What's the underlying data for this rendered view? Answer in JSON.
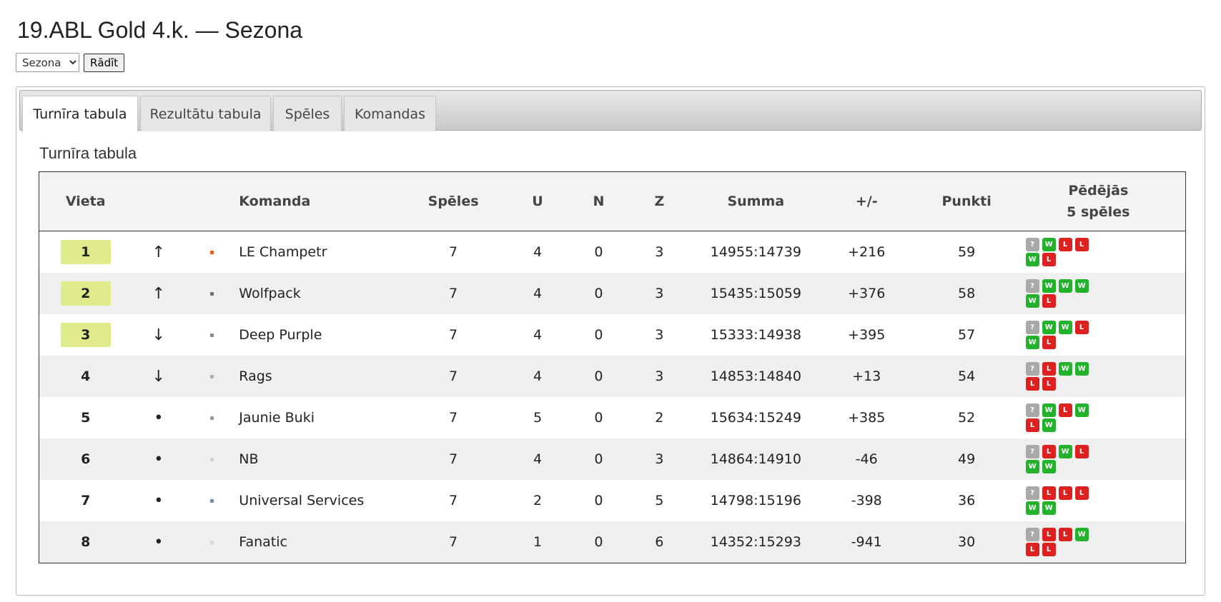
{
  "page": {
    "title": "19.ABL Gold 4.k. — Sezona"
  },
  "controls": {
    "season_selected": "Sezona",
    "show_button": "Rādīt"
  },
  "tabs": [
    {
      "label": "Turnīra tabula",
      "active": true
    },
    {
      "label": "Rezultātu tabula",
      "active": false
    },
    {
      "label": "Spēles",
      "active": false
    },
    {
      "label": "Komandas",
      "active": false
    }
  ],
  "section_title": "Turnīra tabula",
  "table": {
    "headers": {
      "place": "Vieta",
      "team": "Komanda",
      "games": "Spēles",
      "wins": "U",
      "draws": "N",
      "losses": "Z",
      "sum": "Summa",
      "diff": "+/-",
      "points": "Punkti",
      "last5_line1": "Pēdējās",
      "last5_line2": "5 spēles"
    },
    "rows": [
      {
        "place": "1",
        "trend": "↑",
        "logo_color": "#e85a1e",
        "team": "LE Champetr",
        "games": "7",
        "wins": "4",
        "draws": "0",
        "losses": "3",
        "sum": "14955:14739",
        "diff": "+216",
        "points": "59",
        "form": [
          "?",
          "W",
          "L",
          "L",
          "W",
          "L"
        ]
      },
      {
        "place": "2",
        "trend": "↑",
        "logo_color": "#6f6f6f",
        "team": "Wolfpack",
        "games": "7",
        "wins": "4",
        "draws": "0",
        "losses": "3",
        "sum": "15435:15059",
        "diff": "+376",
        "points": "58",
        "form": [
          "?",
          "W",
          "W",
          "W",
          "W",
          "L"
        ]
      },
      {
        "place": "3",
        "trend": "↓",
        "logo_color": "#8a8a8a",
        "team": "Deep Purple",
        "games": "7",
        "wins": "4",
        "draws": "0",
        "losses": "3",
        "sum": "15333:14938",
        "diff": "+395",
        "points": "57",
        "form": [
          "?",
          "W",
          "W",
          "L",
          "W",
          "L"
        ]
      },
      {
        "place": "4",
        "trend": "↓",
        "logo_color": "#b0b0b0",
        "team": "Rags",
        "games": "7",
        "wins": "4",
        "draws": "0",
        "losses": "3",
        "sum": "14853:14840",
        "diff": "+13",
        "points": "54",
        "form": [
          "?",
          "L",
          "W",
          "W",
          "L",
          "L"
        ]
      },
      {
        "place": "5",
        "trend": "•",
        "logo_color": "#9a9a9a",
        "team": "Jaunie Buki",
        "games": "7",
        "wins": "5",
        "draws": "0",
        "losses": "2",
        "sum": "15634:15249",
        "diff": "+385",
        "points": "52",
        "form": [
          "?",
          "W",
          "L",
          "W",
          "L",
          "W"
        ]
      },
      {
        "place": "6",
        "trend": "•",
        "logo_color": "#d0d0d0",
        "team": "NB",
        "games": "7",
        "wins": "4",
        "draws": "0",
        "losses": "3",
        "sum": "14864:14910",
        "diff": "-46",
        "points": "49",
        "form": [
          "?",
          "L",
          "W",
          "L",
          "W",
          "W"
        ]
      },
      {
        "place": "7",
        "trend": "•",
        "logo_color": "#7a8ca0",
        "team": "Universal Services",
        "games": "7",
        "wins": "2",
        "draws": "0",
        "losses": "5",
        "sum": "14798:15196",
        "diff": "-398",
        "points": "36",
        "form": [
          "?",
          "L",
          "L",
          "L",
          "W",
          "W"
        ]
      },
      {
        "place": "8",
        "trend": "•",
        "logo_color": "#d8d8d8",
        "team": "Fanatic",
        "games": "7",
        "wins": "1",
        "draws": "0",
        "losses": "6",
        "sum": "14352:15293",
        "diff": "-941",
        "points": "30",
        "form": [
          "?",
          "L",
          "L",
          "W",
          "L",
          "L"
        ]
      }
    ]
  },
  "colors": {
    "highlight_place": "#e0ec8b",
    "win": "#22b22b",
    "loss": "#dd2020",
    "unknown": "#a9a9a9"
  },
  "icons": {
    "trend_up": "arrow-up-icon",
    "trend_down": "arrow-down-icon",
    "trend_same": "dot-icon"
  }
}
